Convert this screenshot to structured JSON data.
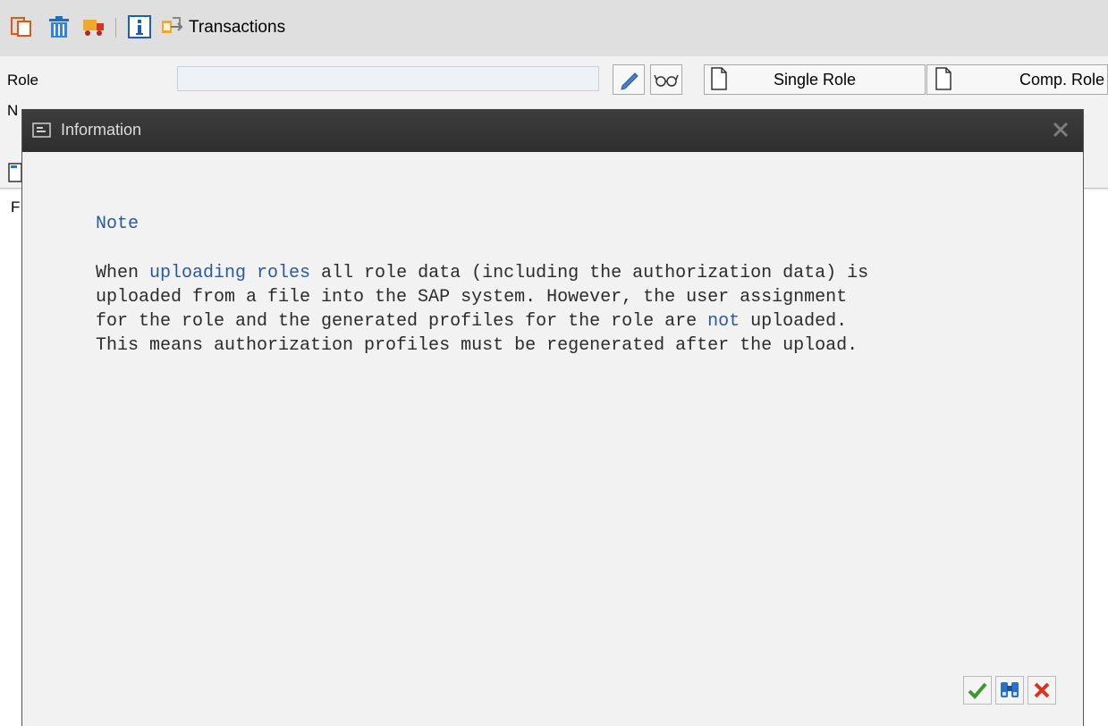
{
  "toolbar": {
    "icons": [
      "copy-icon",
      "delete-icon",
      "transport-icon",
      "info-icon",
      "transactions-icon"
    ],
    "transactions_label": "Transactions"
  },
  "form": {
    "role_label": "Role",
    "role_value": "",
    "second_label_partial": "N",
    "single_role_label": "Single Role",
    "comp_role_label": "Comp. Role",
    "grid_header_partial": "F"
  },
  "dialog": {
    "title": "Information",
    "note_title": "Note",
    "line1_a": "When ",
    "line1_link": "uploading roles",
    "line1_b": " all role data (including the authorization data) is",
    "line2": "uploaded from a file into the SAP system. However, the user assignment",
    "line3_a": "for the role and the generated profiles for the role are ",
    "line3_link": "not",
    "line3_b": " uploaded.",
    "line4": "This means authorization profiles must be regenerated after the upload.",
    "buttons": [
      "confirm-button",
      "find-button",
      "cancel-button"
    ]
  },
  "colors": {
    "link": "#2b5a9c",
    "titlebar": "#333333",
    "toolbar_bg": "#dfdfdf"
  }
}
